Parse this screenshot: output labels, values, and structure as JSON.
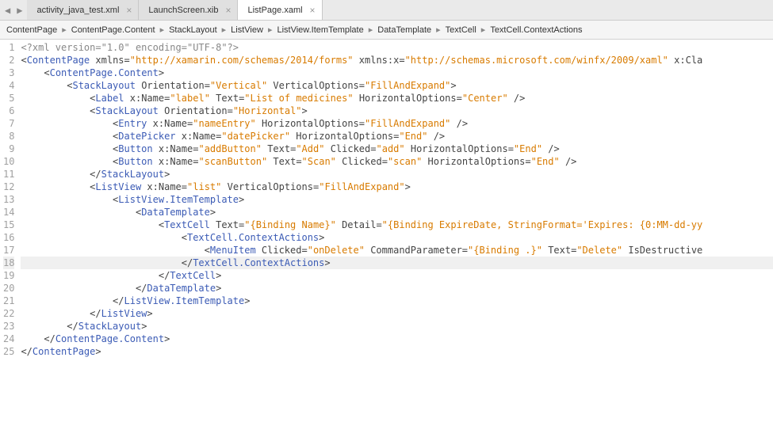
{
  "nav": {
    "back": "◀",
    "fwd": "▶"
  },
  "tabs": [
    {
      "label": "activity_java_test.xml",
      "active": false
    },
    {
      "label": "LaunchScreen.xib",
      "active": false
    },
    {
      "label": "ListPage.xaml",
      "active": true
    }
  ],
  "breadcrumb": [
    "ContentPage",
    "ContentPage.Content",
    "StackLayout",
    "ListView",
    "ListView.ItemTemplate",
    "DataTemplate",
    "TextCell",
    "TextCell.ContextActions"
  ],
  "bc_sep": "▸",
  "gutter": [
    "1",
    "2",
    "3",
    "4",
    "5",
    "6",
    "7",
    "8",
    "9",
    "10",
    "11",
    "12",
    "13",
    "14",
    "15",
    "16",
    "17",
    "18",
    "19",
    "20",
    "21",
    "22",
    "23",
    "24",
    "25"
  ],
  "hl_line": 18,
  "code": {
    "xml_decl": "<?xml version=\"1.0\" encoding=\"UTF-8\"?>",
    "ns1": "\"http://xamarin.com/schemas/2014/forms\"",
    "ns2": "\"http://schemas.microsoft.com/winfx/2009/xaml\"",
    "vertical": "\"Vertical\"",
    "horizontal": "\"Horizontal\"",
    "fillExpand": "\"FillAndExpand\"",
    "center": "\"Center\"",
    "end": "\"End\"",
    "label_name": "\"label\"",
    "label_text": "\"List of medicines\"",
    "nameEntry": "\"nameEntry\"",
    "datePicker": "\"datePicker\"",
    "addButton": "\"addButton\"",
    "addText": "\"Add\"",
    "addClick": "\"add\"",
    "scanButton": "\"scanButton\"",
    "scanText": "\"Scan\"",
    "scanClick": "\"scan\"",
    "list": "\"list\"",
    "bindName": "\"{Binding Name}\"",
    "bindDetail": "\"{Binding ExpireDate, StringFormat='Expires: {0:MM-dd-yy",
    "onDelete": "\"onDelete\"",
    "bindDot": "\"{Binding .}\"",
    "deleteText": "\"Delete\"",
    "tags": {
      "ContentPage": "ContentPage",
      "ContentPageContent": "ContentPage.Content",
      "StackLayout": "StackLayout",
      "Label": "Label",
      "Entry": "Entry",
      "DatePicker": "DatePicker",
      "Button": "Button",
      "ListView": "ListView",
      "ItemTemplate": "ListView.ItemTemplate",
      "DataTemplate": "DataTemplate",
      "TextCell": "TextCell",
      "ContextActions": "TextCell.ContextActions",
      "MenuItem": "MenuItem"
    },
    "attrs": {
      "xmlns": "xmlns",
      "xmlnsx": "xmlns:x",
      "xClass": "x:Cla",
      "Orientation": "Orientation",
      "VerticalOptions": "VerticalOptions",
      "HorizontalOptions": "HorizontalOptions",
      "xName": "x:Name",
      "Text": "Text",
      "Clicked": "Clicked",
      "Detail": "Detail",
      "CommandParameter": "CommandParameter",
      "IsDestructive": "IsDestructive"
    }
  }
}
